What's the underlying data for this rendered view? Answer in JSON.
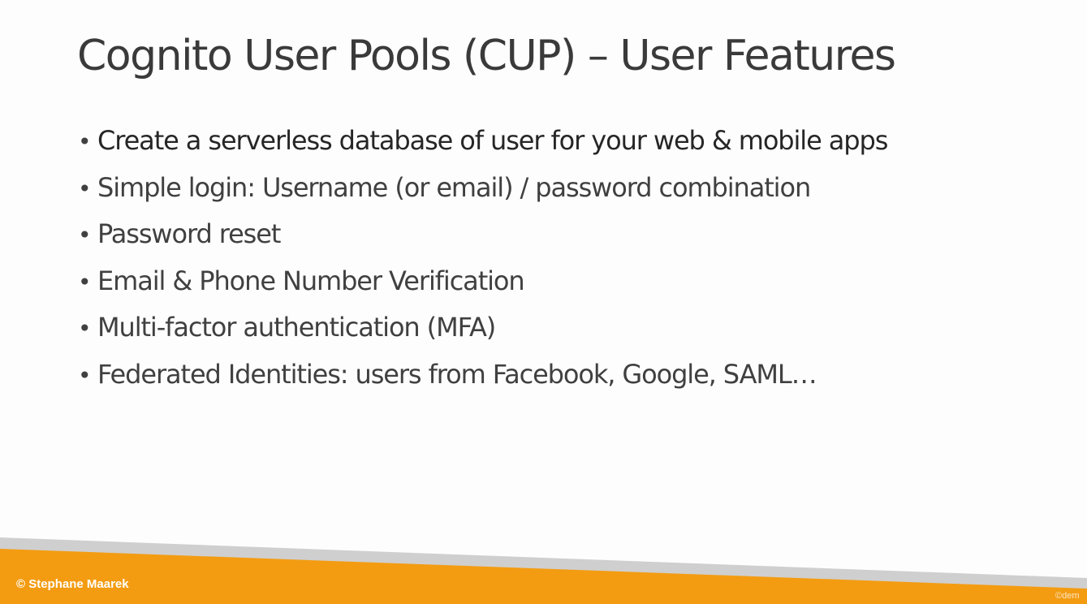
{
  "slide": {
    "title": "Cognito User Pools (CUP) – User Features",
    "bullets": [
      "Create a serverless database of user for your web & mobile apps",
      "Simple login: Username (or email) / password combination",
      "Password reset",
      "Email & Phone Number Verification",
      "Multi-factor authentication (MFA)",
      "Federated Identities: users from Facebook, Google, SAML…"
    ],
    "bullet_symbol": "•"
  },
  "footer": {
    "copyright": "© Stephane Maarek",
    "watermark": "©dem"
  },
  "colors": {
    "background": "#fdfdfd",
    "title": "#3a3a3a",
    "body_text": "#404040",
    "footer_orange": "#f39c12",
    "footer_gray": "#cfcfcf",
    "footer_text": "#ffffff"
  }
}
